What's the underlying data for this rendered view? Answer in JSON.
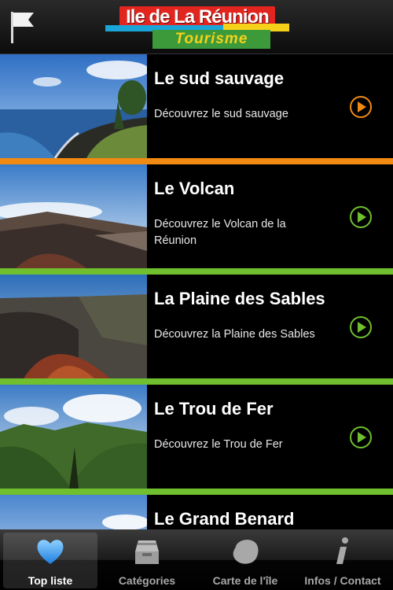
{
  "header": {
    "logo_title": "Ile de La Réunion",
    "logo_subtitle": "Tourisme"
  },
  "list": {
    "items": [
      {
        "title": "Le sud sauvage",
        "description": "Découvrez le sud sauvage",
        "accent_color": "#f08a13"
      },
      {
        "title": "Le Volcan",
        "description": "Découvrez le Volcan de la Réunion",
        "accent_color": "#6fbf2e"
      },
      {
        "title": "La Plaine des Sables",
        "description": "Découvrez la Plaine des Sables",
        "accent_color": "#6fbf2e"
      },
      {
        "title": "Le Trou de Fer",
        "description": "Découvrez le Trou de Fer",
        "accent_color": "#6fbf2e"
      },
      {
        "title": "Le Grand Benard",
        "description": "",
        "accent_color": "#6fbf2e"
      }
    ]
  },
  "tabbar": {
    "tabs": [
      {
        "label": "Top liste",
        "icon": "heart-icon",
        "active": true
      },
      {
        "label": "Catégories",
        "icon": "archive-icon",
        "active": false
      },
      {
        "label": "Carte de l'île",
        "icon": "island-map-icon",
        "active": false
      },
      {
        "label": "Infos / Contact",
        "icon": "info-icon",
        "active": false
      }
    ]
  }
}
